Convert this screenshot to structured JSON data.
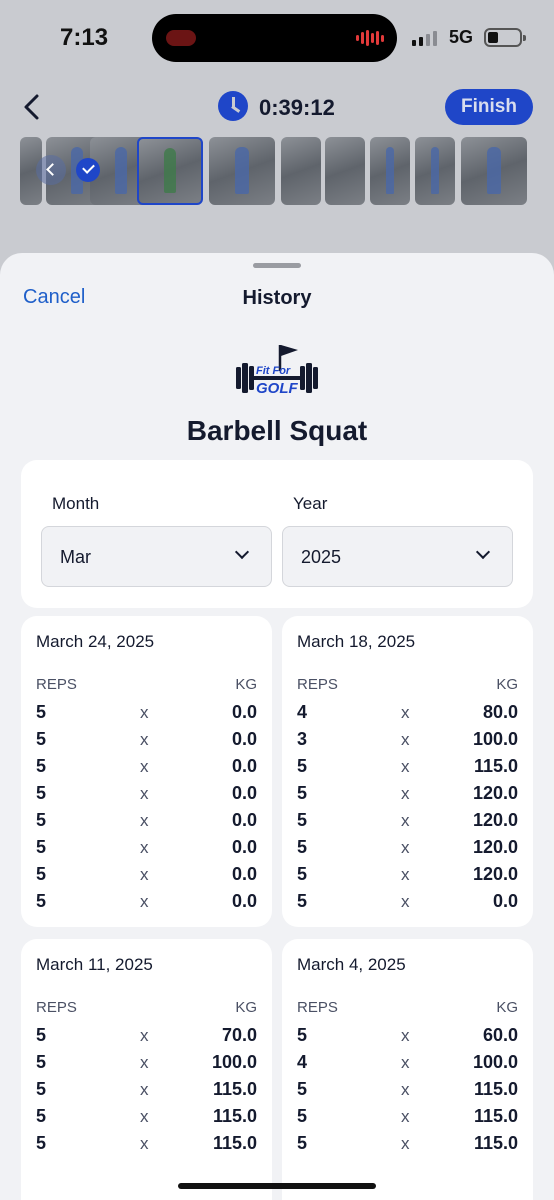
{
  "status_bar": {
    "time": "7:13",
    "network": "5G"
  },
  "workout": {
    "elapsed": "0:39:12",
    "finish_label": "Finish"
  },
  "sheet": {
    "cancel_label": "Cancel",
    "title": "History",
    "logo_text": "Fit For GOLF",
    "exercise": "Barbell Squat"
  },
  "filters": {
    "month_label": "Month",
    "month_value": "Mar",
    "year_label": "Year",
    "year_value": "2025"
  },
  "history_headers": {
    "reps": "REPS",
    "kg": "KG",
    "separator": "x"
  },
  "sessions": [
    {
      "date": "March 24, 2025",
      "sets": [
        {
          "reps": "5",
          "kg": "0.0"
        },
        {
          "reps": "5",
          "kg": "0.0"
        },
        {
          "reps": "5",
          "kg": "0.0"
        },
        {
          "reps": "5",
          "kg": "0.0"
        },
        {
          "reps": "5",
          "kg": "0.0"
        },
        {
          "reps": "5",
          "kg": "0.0"
        },
        {
          "reps": "5",
          "kg": "0.0"
        },
        {
          "reps": "5",
          "kg": "0.0"
        }
      ]
    },
    {
      "date": "March 18, 2025",
      "sets": [
        {
          "reps": "4",
          "kg": "80.0"
        },
        {
          "reps": "3",
          "kg": "100.0"
        },
        {
          "reps": "5",
          "kg": "115.0"
        },
        {
          "reps": "5",
          "kg": "120.0"
        },
        {
          "reps": "5",
          "kg": "120.0"
        },
        {
          "reps": "5",
          "kg": "120.0"
        },
        {
          "reps": "5",
          "kg": "120.0"
        },
        {
          "reps": "5",
          "kg": "0.0"
        }
      ]
    },
    {
      "date": "March 11, 2025",
      "sets": [
        {
          "reps": "5",
          "kg": "70.0"
        },
        {
          "reps": "5",
          "kg": "100.0"
        },
        {
          "reps": "5",
          "kg": "115.0"
        },
        {
          "reps": "5",
          "kg": "115.0"
        },
        {
          "reps": "5",
          "kg": "115.0"
        }
      ]
    },
    {
      "date": "March 4, 2025",
      "sets": [
        {
          "reps": "5",
          "kg": "60.0"
        },
        {
          "reps": "4",
          "kg": "100.0"
        },
        {
          "reps": "5",
          "kg": "115.0"
        },
        {
          "reps": "5",
          "kg": "115.0"
        },
        {
          "reps": "5",
          "kg": "115.0"
        }
      ]
    }
  ],
  "colors": {
    "accent": "#1f46c8",
    "link": "#1f5fc9",
    "text": "#141a2e"
  }
}
